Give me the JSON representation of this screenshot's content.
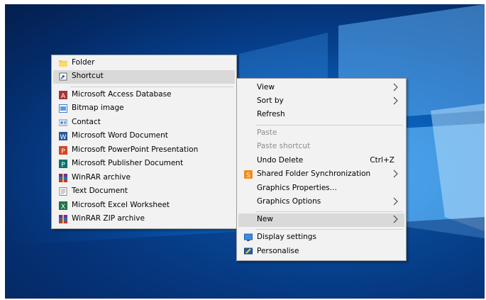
{
  "new_submenu": {
    "items": [
      {
        "label": "Folder",
        "icon": "folder-icon"
      },
      {
        "label": "Shortcut",
        "icon": "shortcut-icon"
      },
      {
        "label": "Microsoft Access Database",
        "icon": "access-icon"
      },
      {
        "label": "Bitmap image",
        "icon": "bitmap-icon"
      },
      {
        "label": "Contact",
        "icon": "contact-icon"
      },
      {
        "label": "Microsoft Word Document",
        "icon": "word-icon"
      },
      {
        "label": "Microsoft PowerPoint Presentation",
        "icon": "powerpoint-icon"
      },
      {
        "label": "Microsoft Publisher Document",
        "icon": "publisher-icon"
      },
      {
        "label": "WinRAR archive",
        "icon": "winrar-icon"
      },
      {
        "label": "Text Document",
        "icon": "text-document-icon"
      },
      {
        "label": "Microsoft Excel Worksheet",
        "icon": "excel-icon"
      },
      {
        "label": "WinRAR ZIP archive",
        "icon": "winrar-zip-icon"
      }
    ]
  },
  "context_menu": {
    "view": "View",
    "sort_by": "Sort by",
    "refresh": "Refresh",
    "paste": "Paste",
    "paste_shortcut": "Paste shortcut",
    "undo_delete": "Undo Delete",
    "undo_delete_shortcut": "Ctrl+Z",
    "shared_folder_sync": "Shared Folder Synchronization",
    "graphics_properties": "Graphics Properties...",
    "graphics_options": "Graphics Options",
    "new": "New",
    "display_settings": "Display settings",
    "personalise": "Personalise"
  },
  "colors": {
    "menu_bg": "#f2f2f2",
    "highlight": "#d9d9d9",
    "disabled_text": "#8d8d8d",
    "wallpaper": "#0a5fb8"
  }
}
